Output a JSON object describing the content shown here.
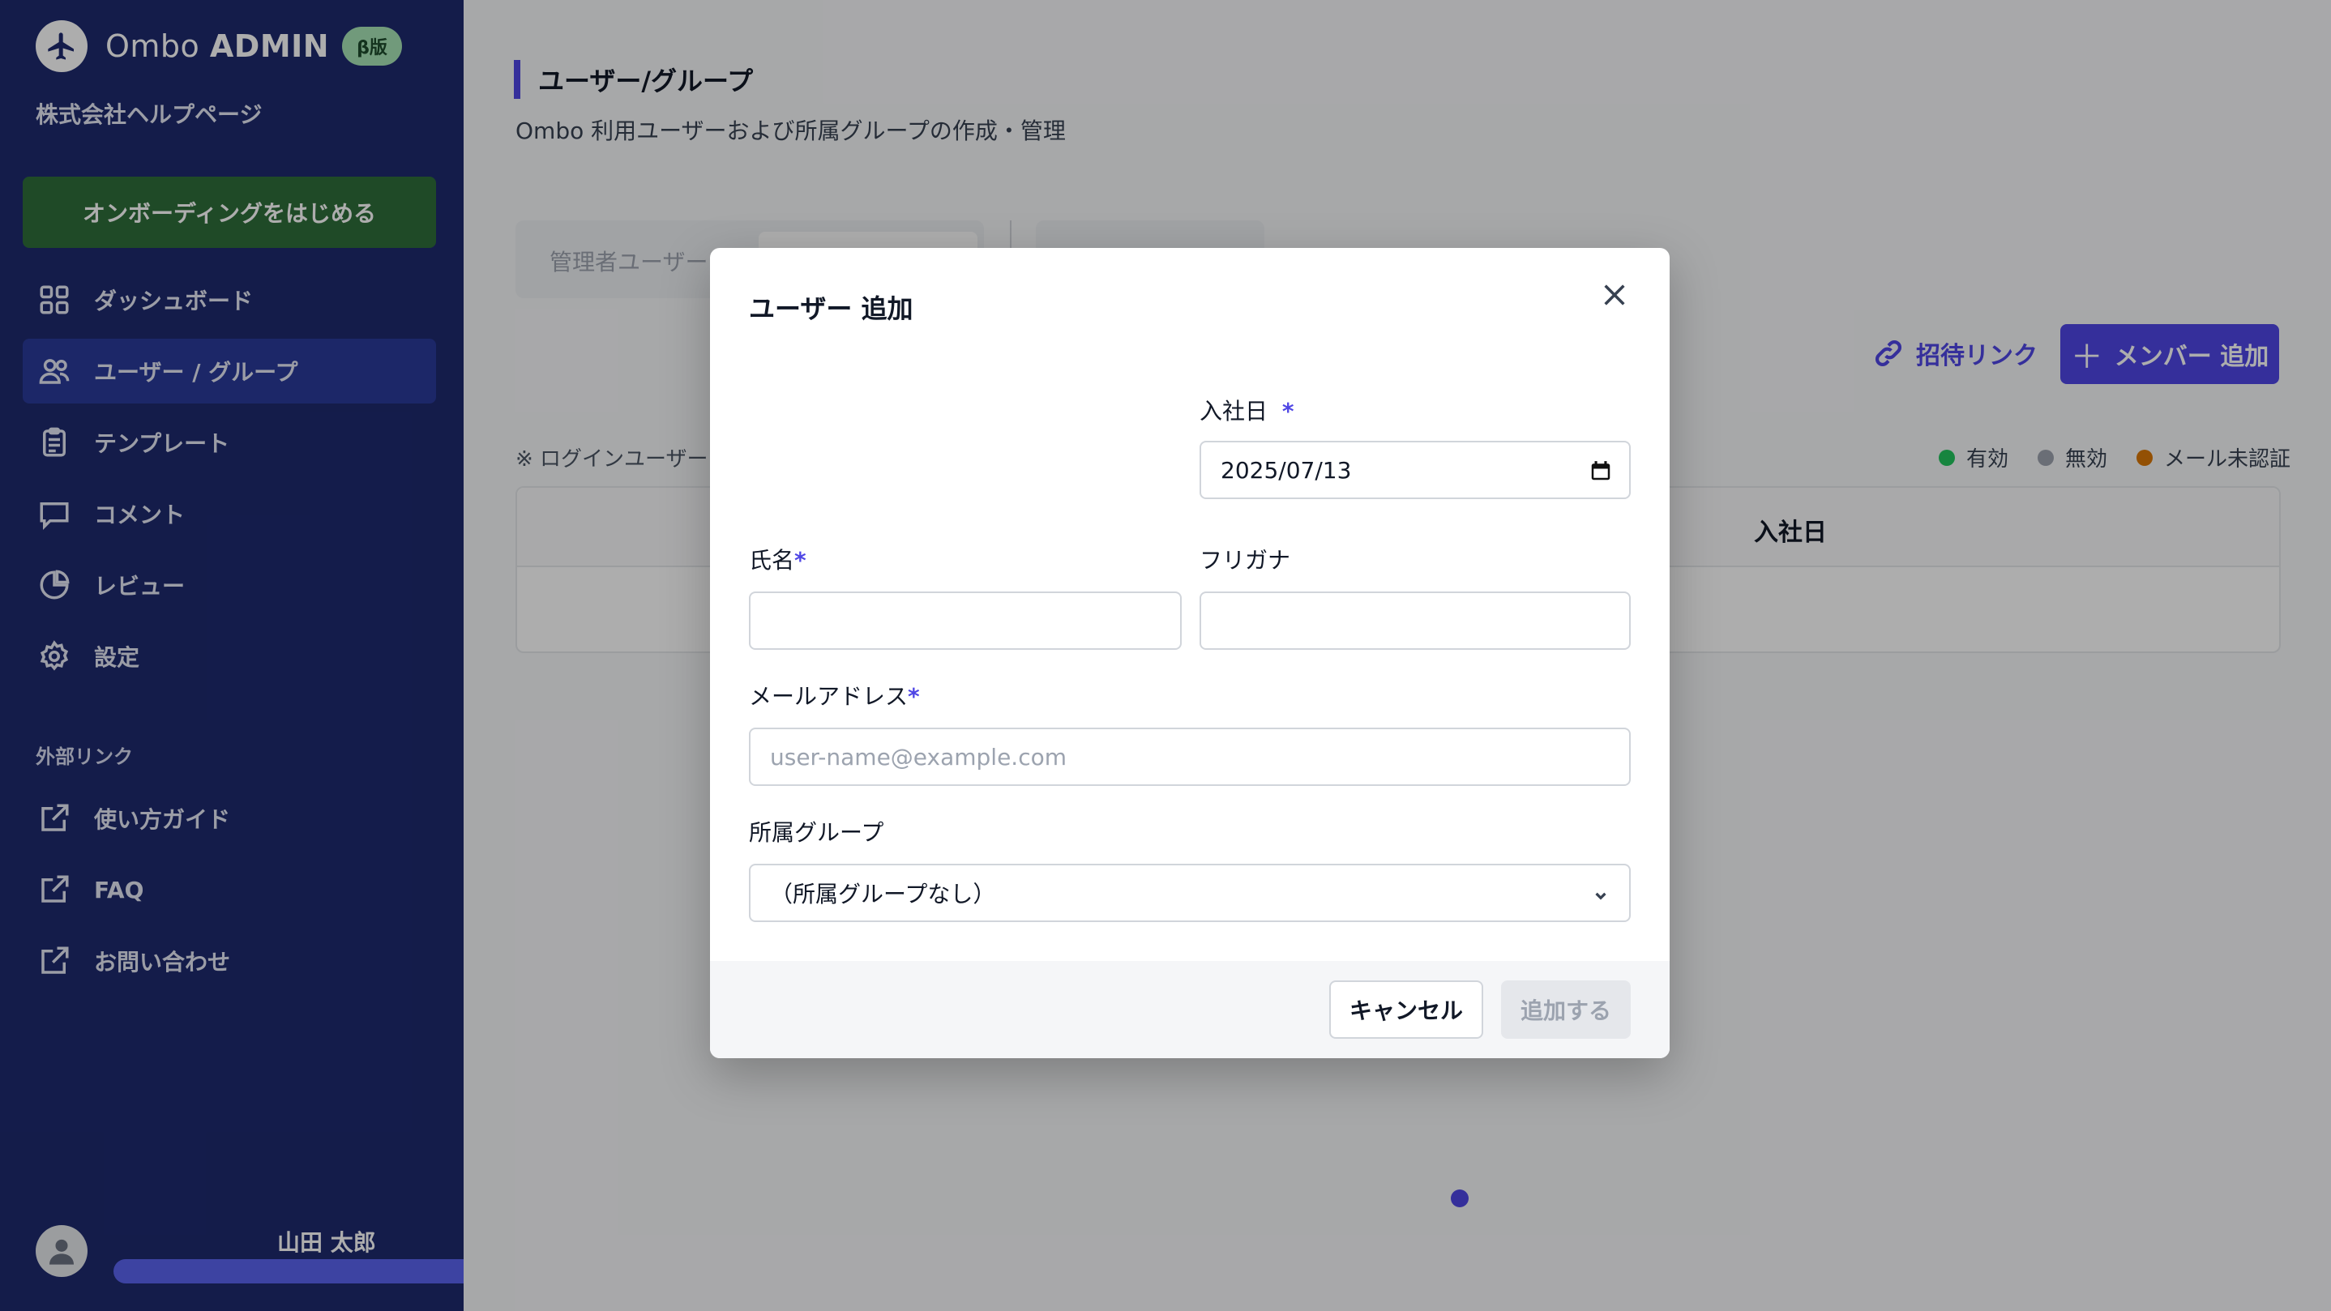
{
  "brand": {
    "name_light": "Ombo",
    "name_bold": "ADMIN",
    "badge": "β版"
  },
  "company": "株式会社ヘルプページ",
  "onboarding_button": "オンボーディングをはじめる",
  "nav": {
    "items": [
      {
        "label": "ダッシュボード",
        "icon": "dashboard-icon"
      },
      {
        "label": "ユーザー / グループ",
        "icon": "users-icon",
        "active": true
      },
      {
        "label": "テンプレート",
        "icon": "clipboard-icon"
      },
      {
        "label": "コメント",
        "icon": "comment-icon"
      },
      {
        "label": "レビュー",
        "icon": "pie-chart-icon"
      },
      {
        "label": "設定",
        "icon": "gear-icon"
      }
    ],
    "external_section": "外部リンク",
    "external": [
      {
        "label": "使い方ガイド",
        "icon": "external-link-icon"
      },
      {
        "label": "FAQ",
        "icon": "external-link-icon"
      },
      {
        "label": "お問い合わせ",
        "icon": "external-link-icon"
      }
    ]
  },
  "user": {
    "name": "山田 太郎",
    "progress": 1.0
  },
  "page": {
    "title": "ユーザー/グループ",
    "subtitle": "Ombo 利用ユーザーおよび所属グループの作成・管理",
    "tab_admin": "管理者ユーザー",
    "invite_link": "招待リンク",
    "add_member": "メンバー 追加",
    "note": "※ ログインユーザー自",
    "legend": [
      {
        "label": "有効",
        "color": "#22c55e"
      },
      {
        "label": "無効",
        "color": "#9ca3af"
      },
      {
        "label": "メール未認証",
        "color": "#d97706"
      }
    ],
    "table_header_date": "入社日"
  },
  "modal": {
    "title": "ユーザー 追加",
    "hire_date_label": "入社日",
    "hire_date_value": "2025/07/13",
    "name_label": "氏名",
    "furigana_label": "フリガナ",
    "email_label": "メールアドレス",
    "email_placeholder": "user-name@example.com",
    "group_label": "所属グループ",
    "group_value": "（所属グループなし）",
    "required_mark": "*",
    "cancel": "キャンセル",
    "submit": "追加する"
  },
  "colors": {
    "sidebar": "#1e2a6e",
    "accent": "#4f46e5",
    "onboarding": "#2f6e3a"
  }
}
